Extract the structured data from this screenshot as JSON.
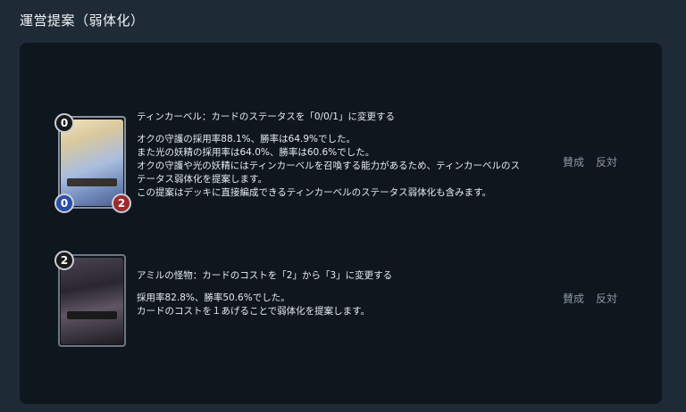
{
  "page": {
    "title": "運営提案（弱体化）"
  },
  "proposals": [
    {
      "card": {
        "cost": "0",
        "attack": "0",
        "defense": "2",
        "art_colors": [
          "#e9d9b0",
          "#b7c7e8",
          "#7f97c7"
        ],
        "frame_color": "#8a94a0"
      },
      "headline": "ティンカーベル：カードのステータスを「0/0/1」に変更する",
      "body": [
        "オクの守護の採用率88.1%、勝率は64.9%でした。",
        "また光の妖精の採用率は64.0%、勝率は60.6%でした。",
        "オクの守護や光の妖精にはティンカーベルを召喚する能力があるため、ティンカーベルのス",
        "テータス弱体化を提案します。",
        "この提案はデッキに直接編成できるティンカーベルのステータス弱体化も含みます。"
      ],
      "approve_label": "賛成",
      "oppose_label": "反対"
    },
    {
      "card": {
        "cost": "2",
        "art_colors": [
          "#3a3540",
          "#1c1a20",
          "#5c5460"
        ],
        "frame_color": "#6f7680"
      },
      "headline": "アミルの怪物：カードのコストを「2」から「3」に変更する",
      "body": [
        "採用率82.8%、勝率50.6%でした。",
        "カードのコストを１あげることで弱体化を提案します。"
      ],
      "approve_label": "賛成",
      "oppose_label": "反対"
    }
  ]
}
